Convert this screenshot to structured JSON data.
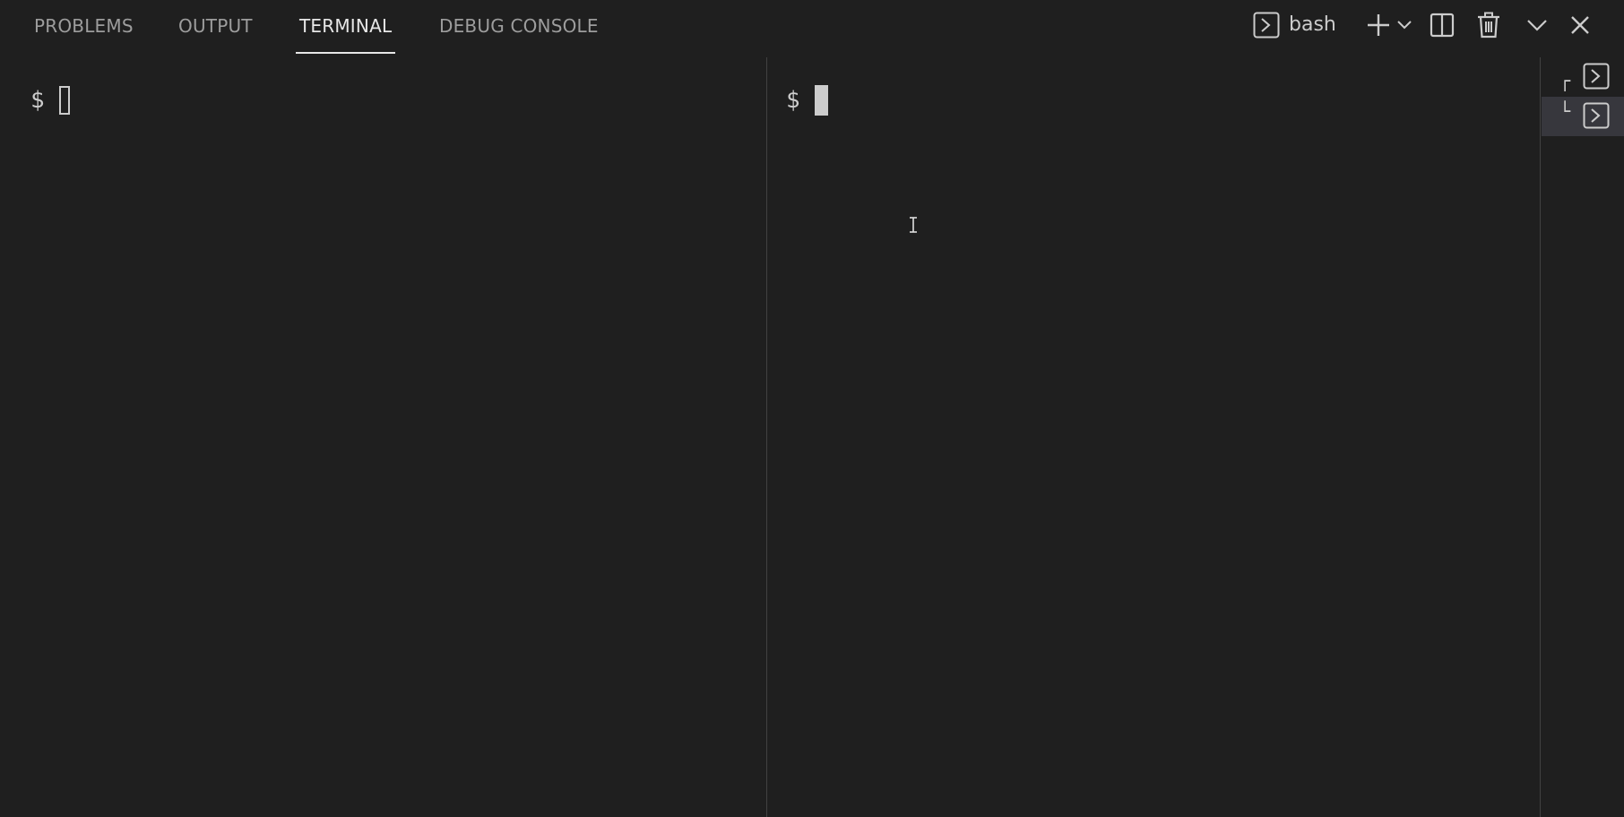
{
  "tabs": [
    {
      "label": "PROBLEMS",
      "active": false
    },
    {
      "label": "OUTPUT",
      "active": false
    },
    {
      "label": "TERMINAL",
      "active": true
    },
    {
      "label": "DEBUG CONSOLE",
      "active": false
    }
  ],
  "toolbar": {
    "terminal_profile_label": "bash",
    "icons": [
      "terminal-icon",
      "plus-icon",
      "chevron-down-icon",
      "split-icon",
      "trash-icon",
      "chevron-down-icon",
      "close-icon"
    ]
  },
  "terminals": {
    "left": {
      "prompt": "$",
      "cursor_style": "outline"
    },
    "right": {
      "prompt": "$",
      "cursor_style": "block"
    }
  },
  "terminal_list": {
    "items": [
      {
        "tree_glyph": "┌",
        "icon": "terminal-icon",
        "selected": false
      },
      {
        "tree_glyph": "└",
        "icon": "terminal-icon",
        "selected": true
      }
    ]
  },
  "colors": {
    "background": "#1f1f1f",
    "foreground": "#cccccc",
    "active_tab": "#e7e7e7",
    "inactive_tab": "#9d9d9d",
    "selected_item": "#37373d",
    "divider": "#414141"
  }
}
